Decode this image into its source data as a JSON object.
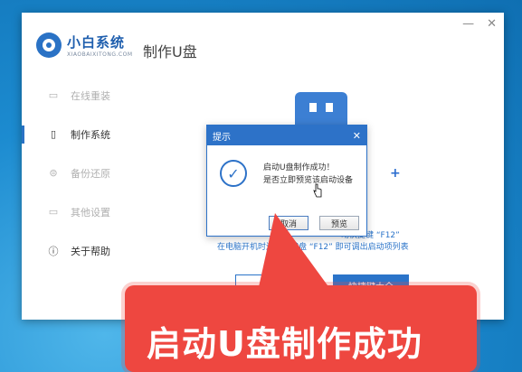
{
  "app": {
    "logo_title": "小白系统",
    "logo_subtitle": "XIAOBAIXITONG.COM",
    "page_title": "制作U盘",
    "controls": {
      "minimize": "—",
      "close": "✕"
    }
  },
  "sidebar": {
    "items": [
      {
        "label": "在线重装",
        "icon": "monitor-icon"
      },
      {
        "label": "制作系统",
        "icon": "usb-icon",
        "active": true
      },
      {
        "label": "备份还原",
        "icon": "database-icon"
      },
      {
        "label": "其他设置",
        "icon": "settings-icon"
      },
      {
        "label": "关于帮助",
        "icon": "info-icon"
      }
    ]
  },
  "main": {
    "hint_line1": "动快捷键 “F12”",
    "hint_line2": "在电脑开机时连续按键盘 “F12” 即可调出启动项列表",
    "button_outline": "返",
    "button_primary": "快捷键大全"
  },
  "dialog": {
    "title": "提示",
    "close": "✕",
    "line1": "启动U盘制作成功！",
    "line2": "是否立即预览该启动设备",
    "cancel": "取消",
    "preview": "预览"
  },
  "banner": {
    "text": "启动U盘制作成功",
    "color": "#ee4740"
  },
  "colors": {
    "accent": "#2d72c8",
    "desktop": "#1a86c9"
  }
}
